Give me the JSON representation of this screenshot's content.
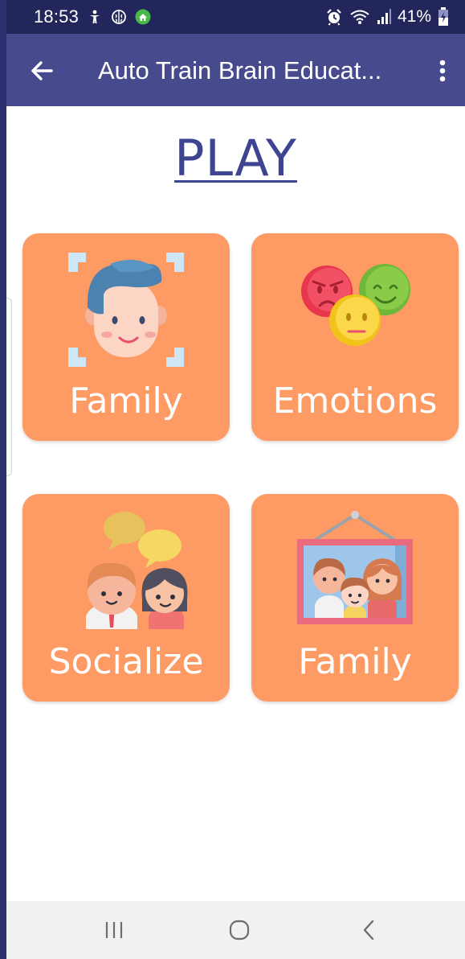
{
  "status_bar": {
    "time": "18:53",
    "battery": "41%",
    "icons": [
      "accessibility-icon",
      "brain-icon",
      "app-icon",
      "alarm-icon",
      "wifi-icon",
      "signal-icon",
      "battery-icon"
    ]
  },
  "app_bar": {
    "title": "Auto Train Brain Educat...",
    "back_icon": "arrow-left-icon",
    "menu_icon": "more-vertical-icon"
  },
  "page": {
    "title": "PLAY"
  },
  "cards": [
    {
      "label": "Family",
      "icon": "face-scan-icon"
    },
    {
      "label": "Emotions",
      "icon": "emotion-faces-icon"
    },
    {
      "label": "Socialize",
      "icon": "chatting-people-icon"
    },
    {
      "label": "Family",
      "icon": "family-portrait-icon"
    }
  ],
  "nav_bar": {
    "icons": [
      "recent-apps-icon",
      "home-icon",
      "back-icon"
    ]
  },
  "colors": {
    "status_bar": "#22265a",
    "app_bar": "#474a8c",
    "title": "#3f4490",
    "card": "#fe9a63",
    "nav_bar": "#f1f1f1"
  }
}
